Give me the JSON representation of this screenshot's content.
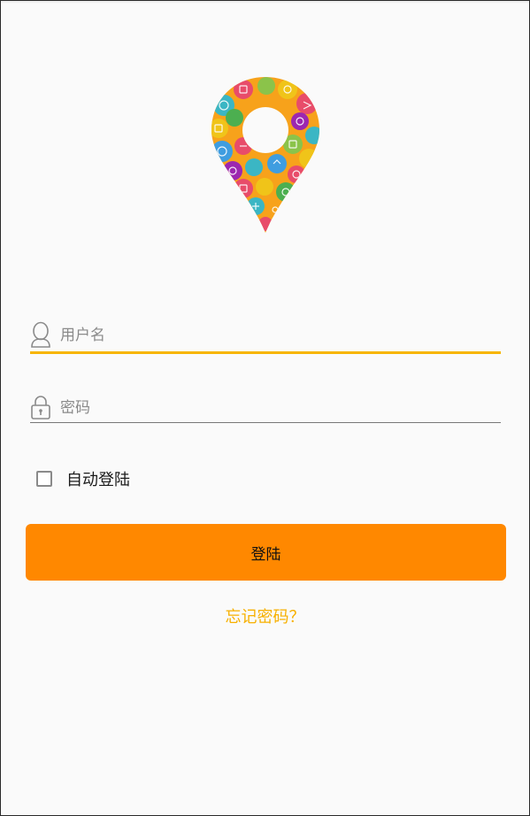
{
  "logo": {
    "icon": "map-pin-icon"
  },
  "username": {
    "placeholder": "用户名",
    "value": "",
    "icon": "user-icon"
  },
  "password": {
    "placeholder": "密码",
    "value": "",
    "icon": "lock-icon"
  },
  "remember": {
    "label": "自动登陆",
    "checked": false
  },
  "login_button": {
    "label": "登陆"
  },
  "forgot_link": {
    "label": "忘记密码？"
  },
  "colors": {
    "accent": "#ff8800",
    "focus_underline": "#f7b500",
    "link": "#f7b000",
    "background": "#fafafa"
  }
}
